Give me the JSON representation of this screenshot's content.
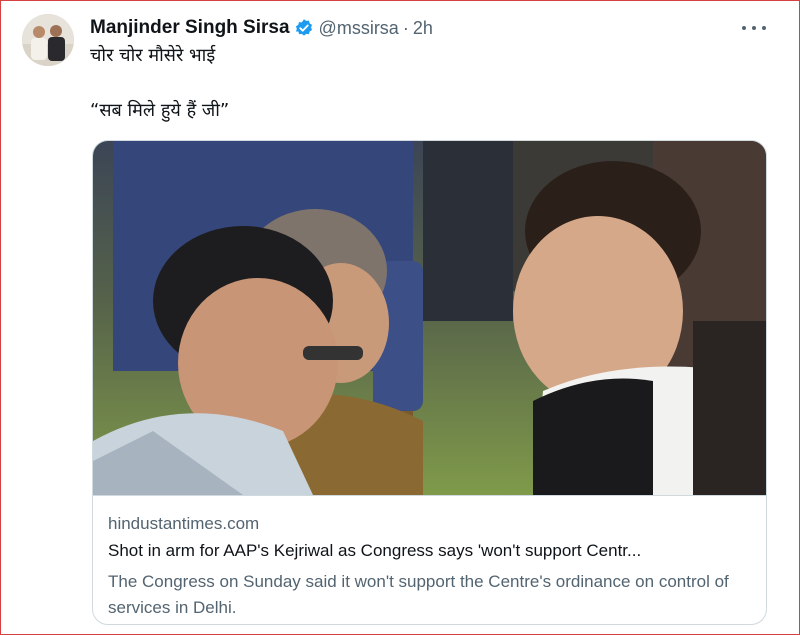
{
  "tweet": {
    "author_name": "Manjinder Singh Sirsa",
    "handle": "@mssirsa",
    "separator": "·",
    "time": "2h",
    "text_line1": "चोर चोर मौसेरे भाई",
    "text_line2": "“सब मिले हुये हैं जी”",
    "verified_icon": "verified-badge-icon",
    "more_icon": "more-options-icon"
  },
  "card": {
    "image_icon": "news-photo",
    "domain": "hindustantimes.com",
    "headline": "Shot in arm for AAP's Kejriwal as Congress says 'won't support Centr...",
    "description": "The Congress on Sunday said it won't support the Centre's ordinance on control of services in Delhi."
  },
  "colors": {
    "verified": "#1d9bf0",
    "secondary_text": "#536471",
    "border": "#cfd9de",
    "frame": "#d64040"
  }
}
